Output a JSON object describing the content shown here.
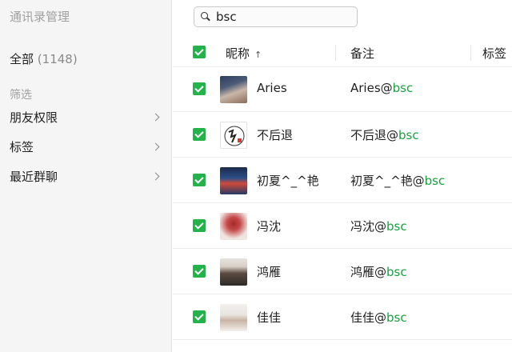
{
  "sidebar": {
    "title": "通讯录管理",
    "all_label": "全部",
    "all_count": "(1148)",
    "filter_label": "筛选",
    "items": [
      {
        "label": "朋友权限"
      },
      {
        "label": "标签"
      },
      {
        "label": "最近群聊"
      }
    ]
  },
  "search": {
    "value": "bsc",
    "icon": "search-icon"
  },
  "table": {
    "headers": {
      "nickname": "昵称",
      "sort_icon": "↑",
      "remark": "备注",
      "tag": "标签"
    },
    "rows": [
      {
        "nickname": "Aries",
        "remark_name": "Aries@",
        "remark_match": "bsc"
      },
      {
        "nickname": "不后退",
        "remark_name": "不后退@",
        "remark_match": "bsc"
      },
      {
        "nickname": "初夏^_^艳",
        "remark_name": "初夏^_^艳@",
        "remark_match": "bsc"
      },
      {
        "nickname": "冯沈",
        "remark_name": "冯沈@",
        "remark_match": "bsc"
      },
      {
        "nickname": "鸿雁",
        "remark_name": "鸿雁@",
        "remark_match": "bsc"
      },
      {
        "nickname": "佳佳",
        "remark_name": "佳佳@",
        "remark_match": "bsc"
      }
    ]
  },
  "colors": {
    "accent_green": "#24b24a",
    "highlight_green": "#1aa03f",
    "sidebar_bg": "#f5f5f5"
  }
}
